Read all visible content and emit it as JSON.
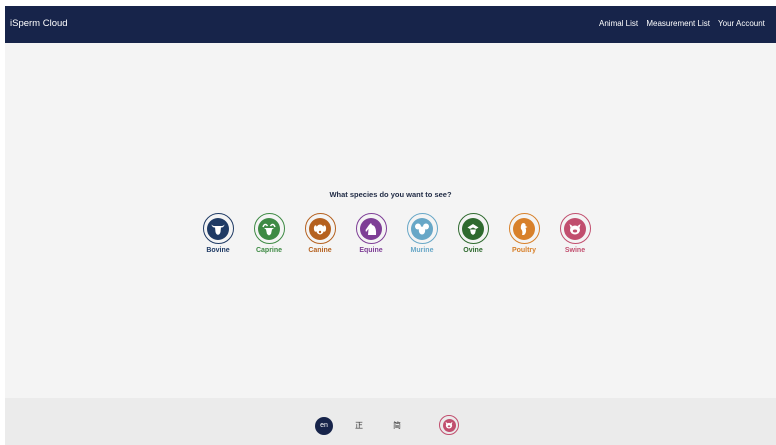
{
  "header": {
    "brand": "iSperm Cloud",
    "nav": [
      "Animal List",
      "Measurement List",
      "Your Account"
    ]
  },
  "main": {
    "question": "What species do you want to see?",
    "species": [
      {
        "label": "Bovine",
        "color": "#1f3a64",
        "icon": "bull-icon"
      },
      {
        "label": "Caprine",
        "color": "#3e8a44",
        "icon": "goat-icon"
      },
      {
        "label": "Canine",
        "color": "#b5611f",
        "icon": "dog-icon"
      },
      {
        "label": "Equine",
        "color": "#7e3e96",
        "icon": "horse-icon"
      },
      {
        "label": "Murine",
        "color": "#67a7c7",
        "icon": "mouse-icon"
      },
      {
        "label": "Ovine",
        "color": "#2f6a2f",
        "icon": "sheep-icon"
      },
      {
        "label": "Poultry",
        "color": "#d8802a",
        "icon": "chicken-icon"
      },
      {
        "label": "Swine",
        "color": "#c14e6e",
        "icon": "pig-icon"
      }
    ]
  },
  "footer": {
    "languages": [
      "en",
      "正",
      "简"
    ],
    "selected_language": "en",
    "selected_species_icon": "pig-icon"
  }
}
